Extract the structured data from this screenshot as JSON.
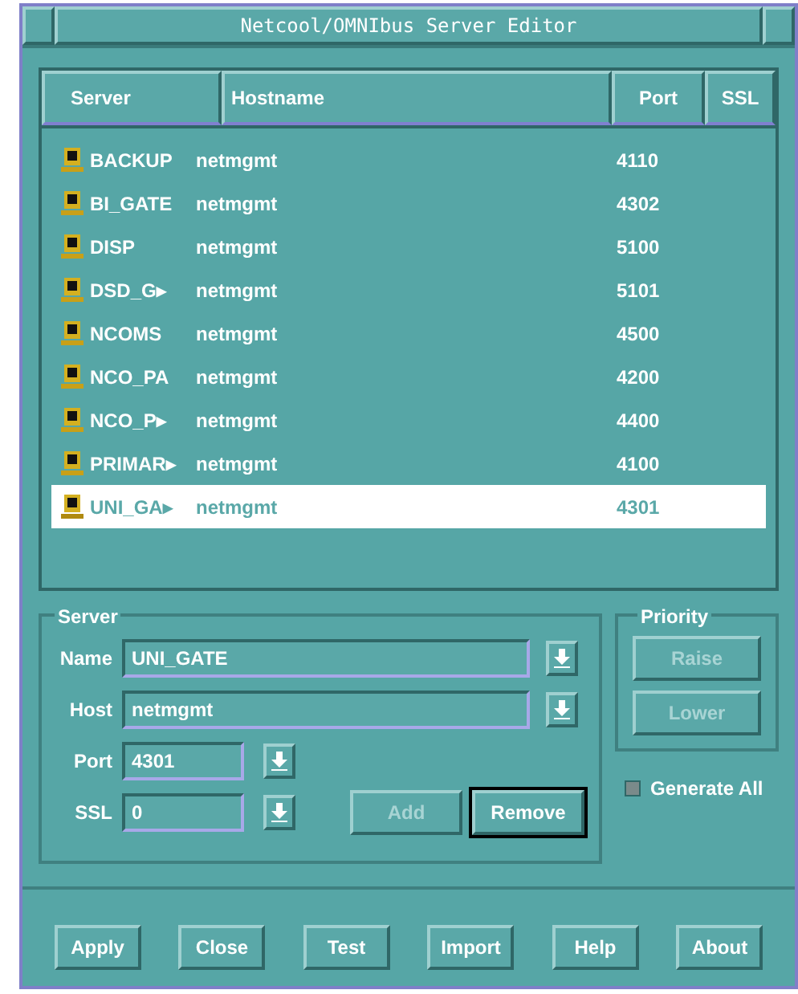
{
  "window": {
    "title": "Netcool/OMNIbus Server Editor"
  },
  "table": {
    "columns": [
      "Server",
      "Hostname",
      "Port",
      "SSL"
    ],
    "rows": [
      {
        "server": "BACKUP",
        "host": "netmgmt",
        "port": "4110",
        "selected": false
      },
      {
        "server": "BI_GATE",
        "host": "netmgmt",
        "port": "4302",
        "selected": false
      },
      {
        "server": "DISP",
        "host": "netmgmt",
        "port": "5100",
        "selected": false
      },
      {
        "server": "DSD_G▸",
        "host": "netmgmt",
        "port": "5101",
        "selected": false
      },
      {
        "server": "NCOMS",
        "host": "netmgmt",
        "port": "4500",
        "selected": false
      },
      {
        "server": "NCO_PA",
        "host": "netmgmt",
        "port": "4200",
        "selected": false
      },
      {
        "server": "NCO_P▸",
        "host": "netmgmt",
        "port": "4400",
        "selected": false
      },
      {
        "server": "PRIMAR▸",
        "host": "netmgmt",
        "port": "4100",
        "selected": false
      },
      {
        "server": "UNI_GA▸",
        "host": "netmgmt",
        "port": "4301",
        "selected": true
      }
    ]
  },
  "server_group": {
    "title": "Server",
    "fields": [
      {
        "label": "Name",
        "value": "UNI_GATE",
        "wide": true
      },
      {
        "label": "Host",
        "value": "netmgmt",
        "wide": true
      },
      {
        "label": "Port",
        "value": "4301",
        "wide": false
      },
      {
        "label": "SSL",
        "value": "0",
        "wide": false
      }
    ],
    "buttons": [
      {
        "label": "Add",
        "disabled": true,
        "default": false
      },
      {
        "label": "Remove",
        "disabled": false,
        "default": true
      }
    ]
  },
  "priority_group": {
    "title": "Priority",
    "buttons": [
      {
        "label": "Raise",
        "disabled": true
      },
      {
        "label": "Lower",
        "disabled": true
      }
    ]
  },
  "generate_all": {
    "label": "Generate All",
    "checked": false
  },
  "buttons": [
    "Apply",
    "Close",
    "Test",
    "Import",
    "Help",
    "About"
  ]
}
